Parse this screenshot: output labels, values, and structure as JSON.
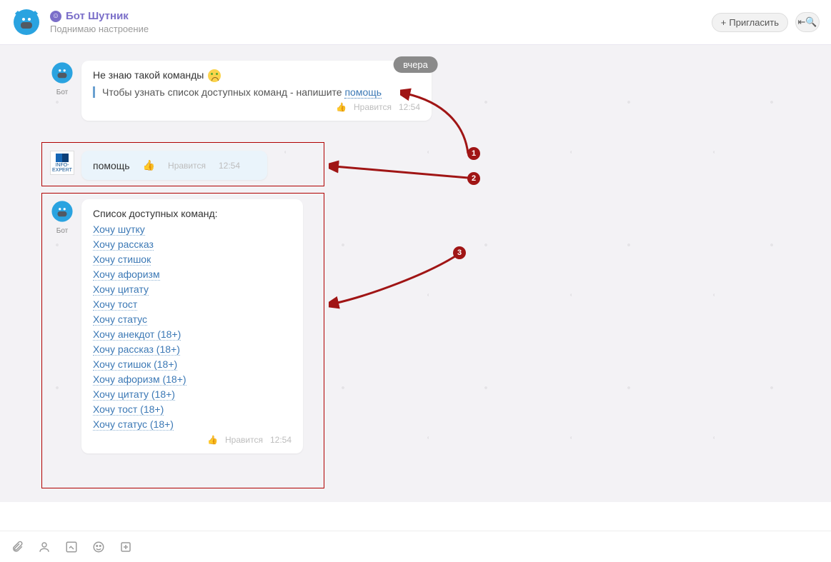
{
  "header": {
    "title": "Бот Шутник",
    "subtitle": "Поднимаю настроение",
    "invite": "Пригласить"
  },
  "date_label": "вчера",
  "avatar_bot_label": "Бот",
  "msg1": {
    "text": "Не знаю такой команды",
    "quote_prefix": "Чтобы узнать список доступных команд - напишите ",
    "quote_link": "помощь",
    "like": "Нравится",
    "time": "12:54"
  },
  "msg2": {
    "text": "помощь",
    "like": "Нравится",
    "time": "12:54"
  },
  "msg3": {
    "heading": "Список доступных команд:",
    "commands": [
      "Хочу шутку",
      "Хочу рассказ",
      "Хочу стишок",
      "Хочу афоризм",
      "Хочу цитату",
      "Хочу тост",
      "Хочу статус",
      "Хочу анекдот (18+)",
      "Хочу рассказ (18+)",
      "Хочу стишок (18+)",
      "Хочу афоризм (18+)",
      "Хочу цитату (18+)",
      "Хочу тост (18+)",
      "Хочу статус (18+)"
    ],
    "like": "Нравится",
    "time": "12:54"
  },
  "annotations": {
    "n1": "1",
    "n2": "2",
    "n3": "3"
  }
}
